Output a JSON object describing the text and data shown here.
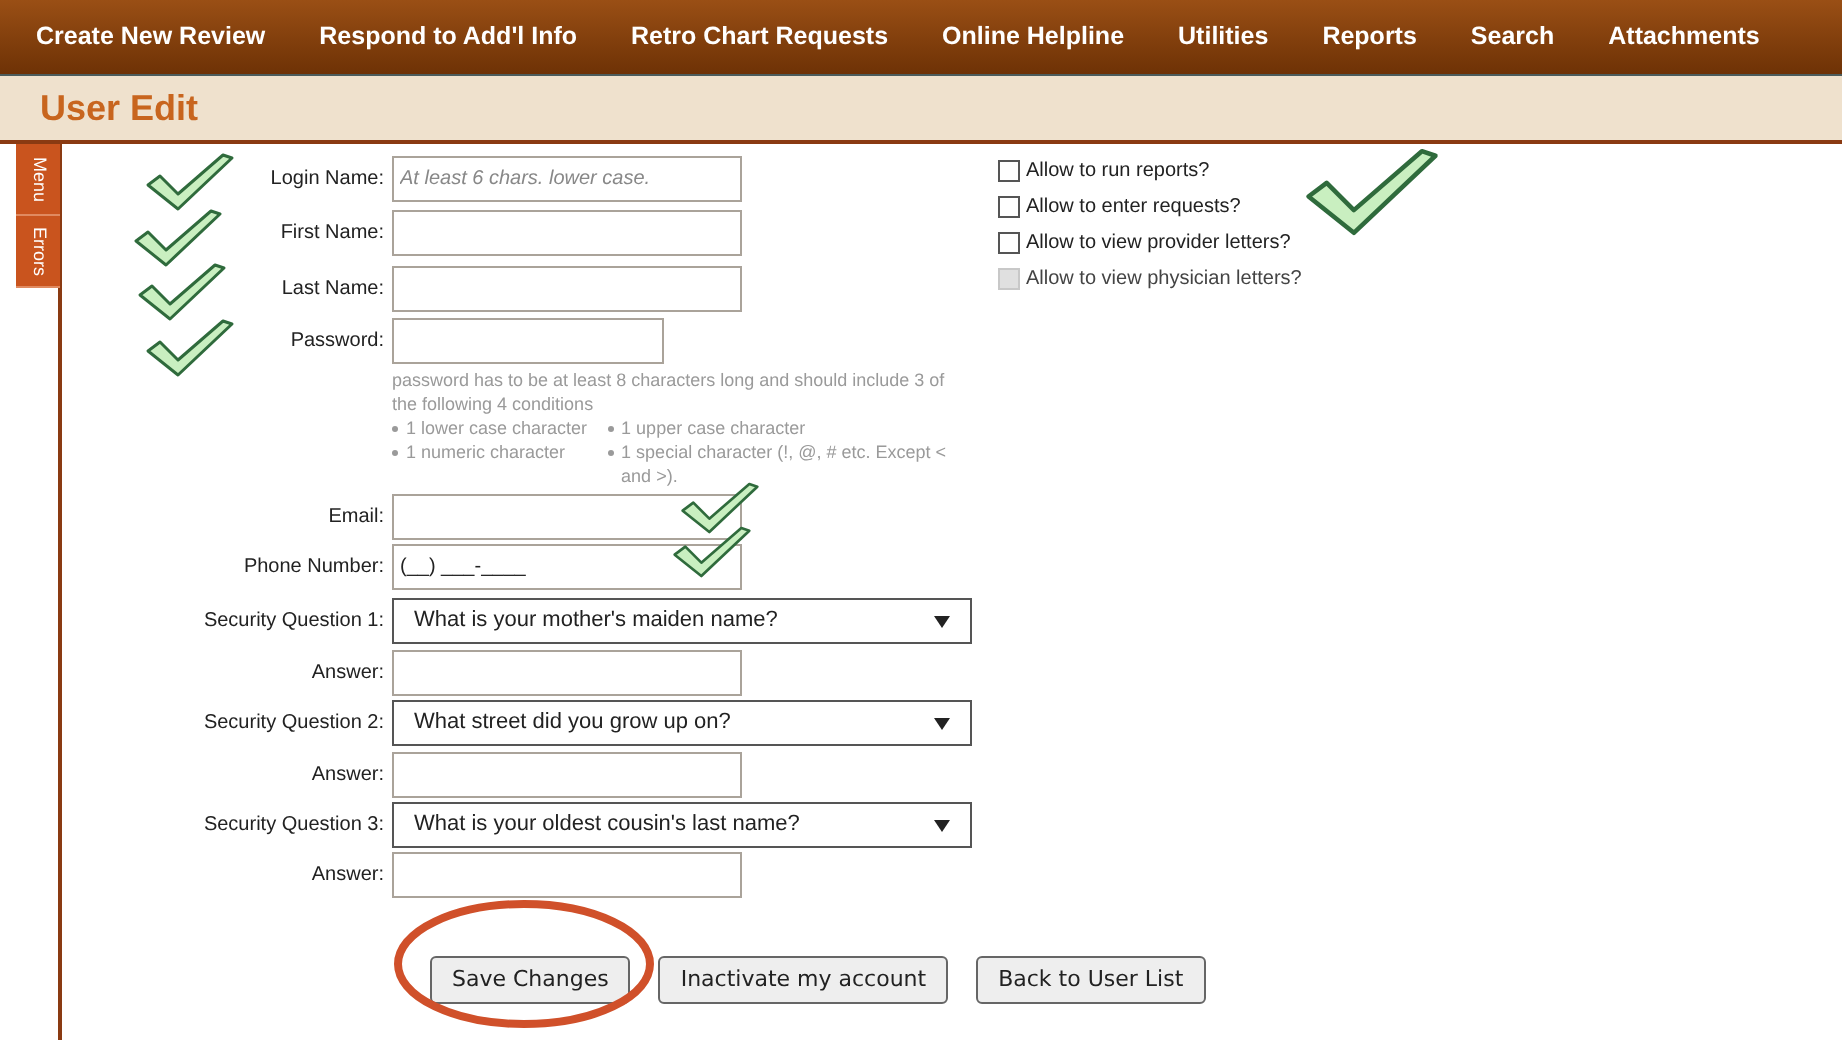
{
  "nav": {
    "items": [
      "Create New Review",
      "Respond to Add'l Info",
      "Retro Chart Requests",
      "Online Helpline",
      "Utilities",
      "Reports",
      "Search",
      "Attachments"
    ]
  },
  "page_title": "User Edit",
  "side_tabs": [
    "Menu",
    "Errors"
  ],
  "form": {
    "fields": [
      {
        "kind": "text",
        "label": "Login Name:",
        "placeholder": "At least 6 chars. lower case."
      },
      {
        "kind": "text",
        "label": "First Name:"
      },
      {
        "kind": "text",
        "label": "Last Name:"
      },
      {
        "kind": "password",
        "label": "Password:",
        "hint": "password has to be at least 8 characters long and should include 3 of the following 4 conditions",
        "rules": [
          "1 lower case character",
          "1 upper case character",
          "1 numeric character",
          "1 special character (!, @, # etc. Except < and >)."
        ]
      },
      {
        "kind": "text",
        "label": "Email:"
      },
      {
        "kind": "text",
        "label": "Phone Number:",
        "value": "(__) ___-____"
      },
      {
        "kind": "select",
        "label": "Security Question 1:",
        "value": "What is your mother's maiden name?"
      },
      {
        "kind": "text",
        "label": "Answer:"
      },
      {
        "kind": "select",
        "label": "Security Question 2:",
        "value": "What street did you grow up on?"
      },
      {
        "kind": "text",
        "label": "Answer:"
      },
      {
        "kind": "select",
        "label": "Security Question 3:",
        "value": "What is your oldest cousin's last name?"
      },
      {
        "kind": "text",
        "label": "Answer:"
      }
    ],
    "permissions": [
      {
        "label": "Allow to run reports?",
        "checked": false,
        "disabled": false
      },
      {
        "label": "Allow to enter requests?",
        "checked": false,
        "disabled": false
      },
      {
        "label": "Allow to view provider letters?",
        "checked": false,
        "disabled": false
      },
      {
        "label": "Allow to view physician letters?",
        "checked": false,
        "disabled": true
      }
    ],
    "buttons": [
      "Save Changes",
      "Inactivate my account",
      "Back to User List"
    ]
  }
}
